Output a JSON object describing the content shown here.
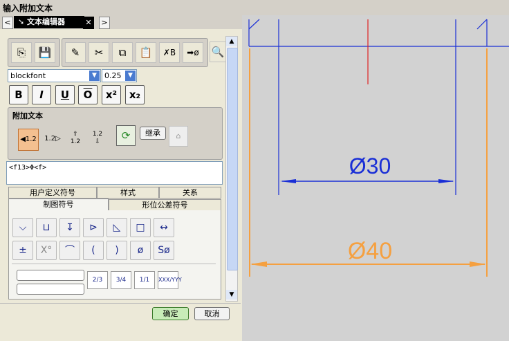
{
  "window": {
    "title": "输入附加文本"
  },
  "tab": {
    "label": "文本编辑器"
  },
  "font": {
    "name": "blockfont",
    "size": "0.25"
  },
  "format_buttons": {
    "bold": "B",
    "italic": "I",
    "underline": "U",
    "overline": "O",
    "superscript": "x²",
    "subscript": "x₂"
  },
  "attach": {
    "title": "附加文本",
    "before_label": "1.2",
    "after_label": "1.2",
    "above_label": "1.2",
    "below_label": "1.2",
    "inherit_label": "继承"
  },
  "text_area": {
    "value": "<f13>Φ<f>"
  },
  "tabs_top": [
    "用户定义符号",
    "样式",
    "关系"
  ],
  "tabs_bottom": [
    "制图符号",
    "形位公差符号"
  ],
  "symbols_row1": [
    "⌵",
    "⊔",
    "↧",
    "⊳",
    "◺",
    "□",
    "↔"
  ],
  "symbols_row2": [
    "±",
    "X°",
    "⌒",
    "(",
    ")",
    "ø",
    "Sø"
  ],
  "fractions": [
    "2/3",
    "3/4",
    "1/1",
    "XXX/YYY"
  ],
  "buttons": {
    "ok": "确定",
    "cancel": "取消"
  },
  "drawing": {
    "dim_inner": "Ø30",
    "dim_outer": "Ø40",
    "colors": {
      "blue": "#1a2fd6",
      "orange": "#f5a040",
      "red": "#e02020"
    }
  }
}
